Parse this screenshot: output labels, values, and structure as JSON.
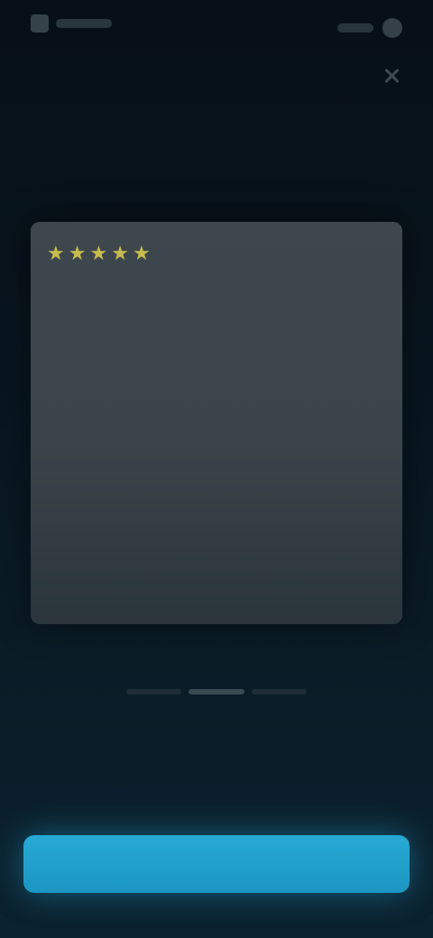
{
  "header": {
    "logo_icon": "app-logo-icon",
    "account_icon": "avatar-icon",
    "close_icon": "close-icon"
  },
  "headline": "",
  "review": {
    "rating": 5,
    "reviewer": "",
    "text": "",
    "read_more": ""
  },
  "carousel": {
    "pages": 3,
    "active_index": 1
  },
  "footer": {
    "prompt": "",
    "accent": ""
  },
  "cta": {
    "label": ""
  },
  "colors": {
    "background": "#08141d",
    "card": "#3d474d",
    "stars": "#c8bc4f",
    "accent": "#2f9fc3",
    "cta": "#1c96c3"
  }
}
